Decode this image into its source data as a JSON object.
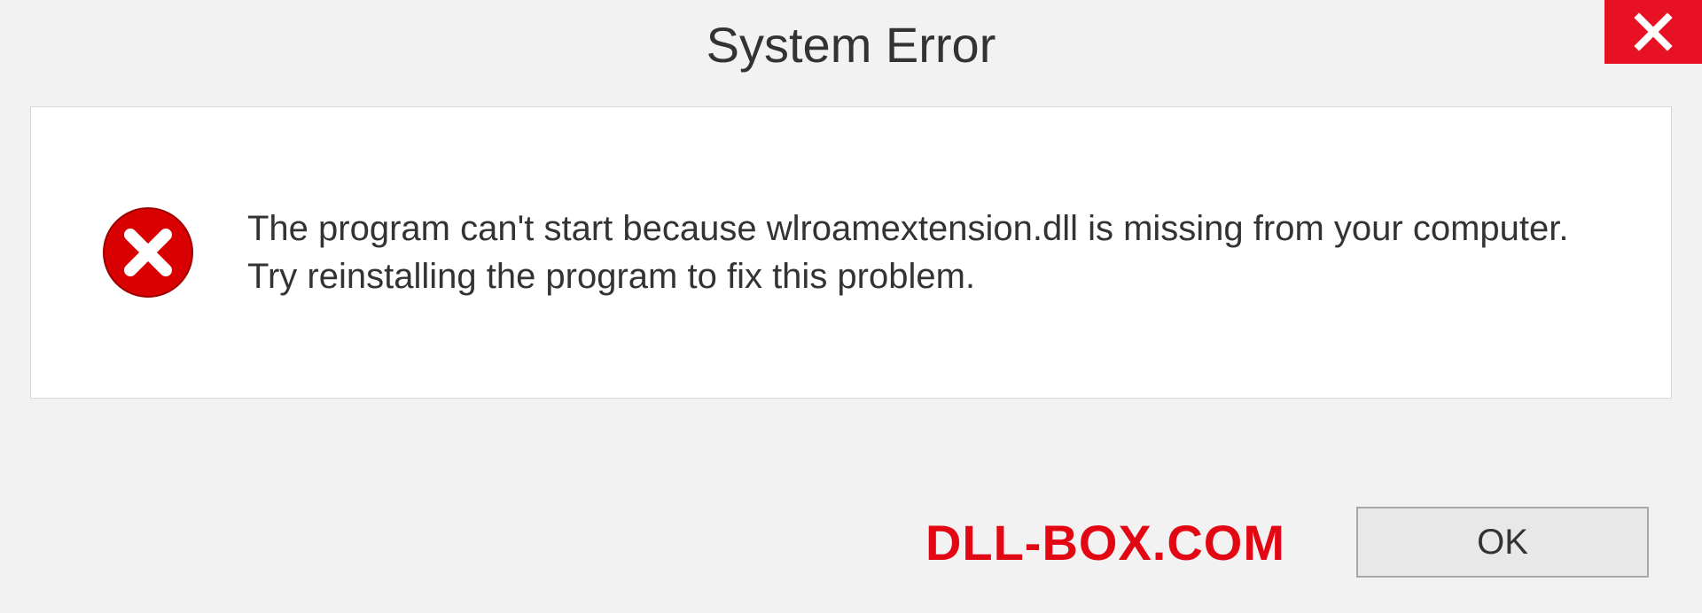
{
  "dialog": {
    "title": "System Error",
    "message": "The program can't start because wlroamextension.dll is missing from your computer. Try reinstalling the program to fix this problem.",
    "ok_label": "OK"
  },
  "watermark": "DLL-BOX.COM",
  "icons": {
    "close": "close-icon",
    "error": "error-circle-x-icon"
  },
  "colors": {
    "close_bg": "#e81123",
    "error_red": "#d80000",
    "watermark_red": "#e30613"
  }
}
